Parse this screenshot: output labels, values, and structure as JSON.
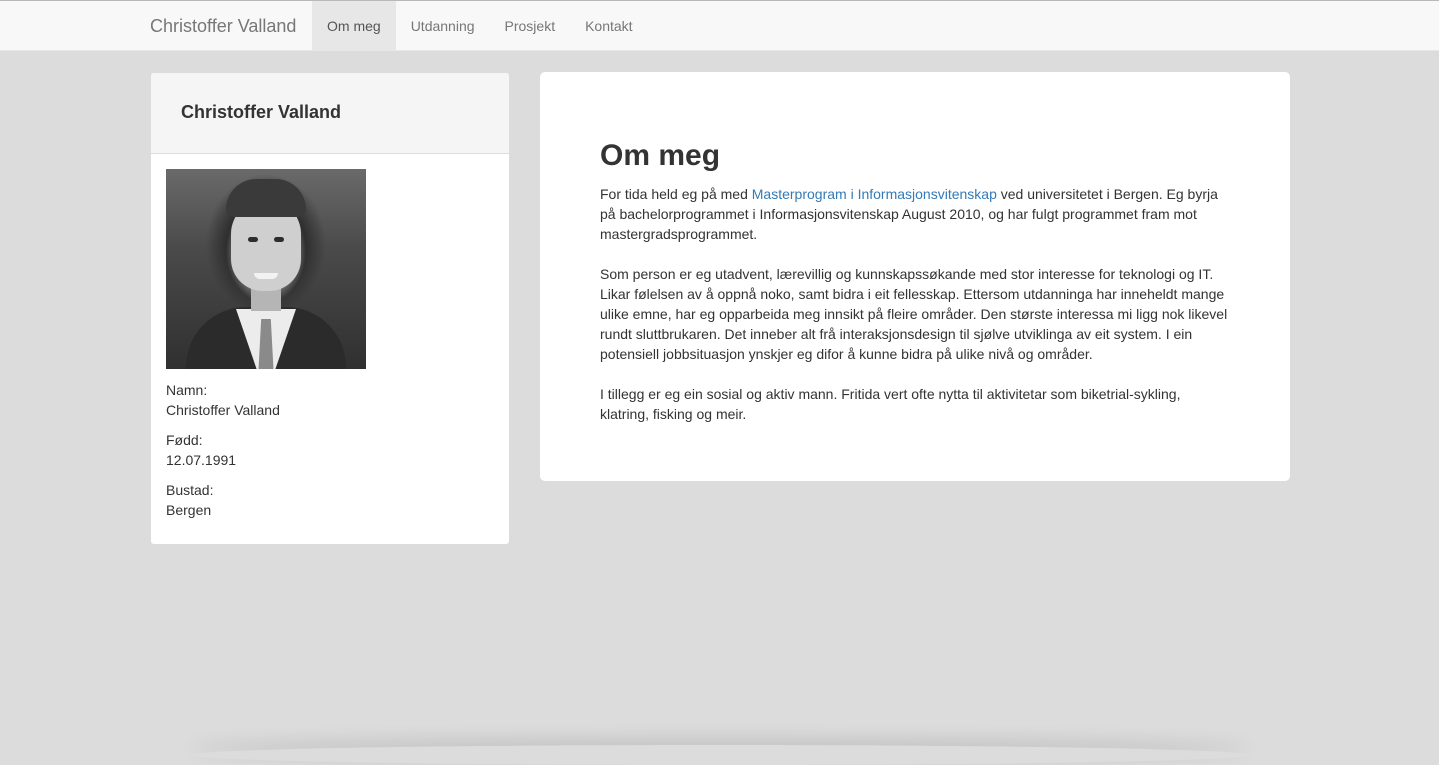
{
  "navbar": {
    "brand": "Christoffer Valland",
    "items": [
      {
        "label": "Om meg",
        "active": true
      },
      {
        "label": "Utdanning",
        "active": false
      },
      {
        "label": "Prosjekt",
        "active": false
      },
      {
        "label": "Kontakt",
        "active": false
      }
    ]
  },
  "profile": {
    "title": "Christoffer Valland",
    "fields": [
      {
        "label": "Namn:",
        "value": "Christoffer Valland"
      },
      {
        "label": "Fødd:",
        "value": "12.07.1991"
      },
      {
        "label": "Bustad:",
        "value": "Bergen"
      }
    ]
  },
  "about": {
    "heading": "Om meg",
    "p1_before": "For tida held eg på med ",
    "p1_link": "Masterprogram i Informasjonsvitenskap",
    "p1_after": " ved universitetet i Bergen. Eg byrja på bachelorprogrammet i Informasjonsvitenskap August 2010, og har fulgt programmet fram mot mastergradsprogrammet.",
    "p2": "Som person er eg utadvent, lærevillig og kunnskapssøkande med stor interesse for teknologi og IT. Likar følelsen av å oppnå noko, samt bidra i eit fellesskap. Ettersom utdanninga har inneheldt mange ulike emne, har eg opparbeida meg innsikt på fleire områder. Den største interessa mi ligg nok likevel rundt sluttbrukaren. Det inneber alt frå interaksjonsdesign til sjølve utviklinga av eit system. I ein potensiell jobbsituasjon ynskjer eg difor å kunne bidra på ulike nivå og områder.",
    "p3": "I tillegg er eg ein sosial og aktiv mann. Fritida vert ofte nytta til aktivitetar som biketrial-sykling, klatring, fisking og meir."
  },
  "colors": {
    "page_bg": "#dcdcdc",
    "link": "#337ab7",
    "nav_active_bg": "#e7e7e7"
  }
}
